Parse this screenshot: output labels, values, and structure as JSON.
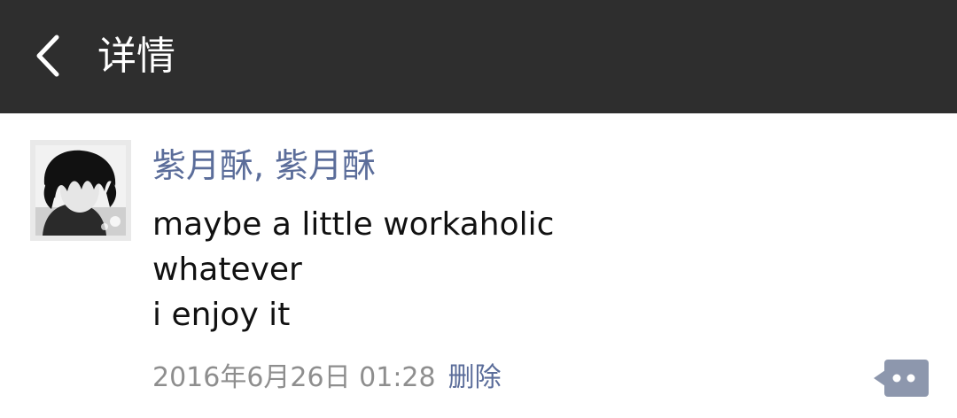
{
  "header": {
    "title": "详情",
    "back_icon": "chevron-left-icon"
  },
  "post": {
    "author": "紫月酥, 紫月酥",
    "content_lines": [
      "maybe a little workaholic",
      "whatever",
      "i enjoy it"
    ],
    "timestamp": "2016年6月26日 01:28",
    "delete_label": "删除",
    "more_icon": "comment-more-icon"
  },
  "colors": {
    "header_bg": "#2e2e2e",
    "link_blue": "#5b6d9a",
    "meta_gray": "#8e8e8e"
  }
}
